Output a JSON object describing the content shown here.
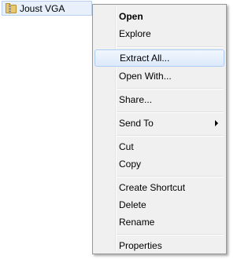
{
  "file": {
    "name": "Joust VGA",
    "icon": "zip-folder-icon"
  },
  "menu": {
    "items": {
      "open": "Open",
      "explore": "Explore",
      "extract_all": "Extract All...",
      "open_with": "Open With...",
      "share": "Share...",
      "send_to": "Send To",
      "cut": "Cut",
      "copy": "Copy",
      "create_shortcut": "Create Shortcut",
      "delete": "Delete",
      "rename": "Rename",
      "properties": "Properties"
    },
    "highlighted": "Extract All...",
    "submenu_arrow_icon": "chevron-right-icon"
  }
}
